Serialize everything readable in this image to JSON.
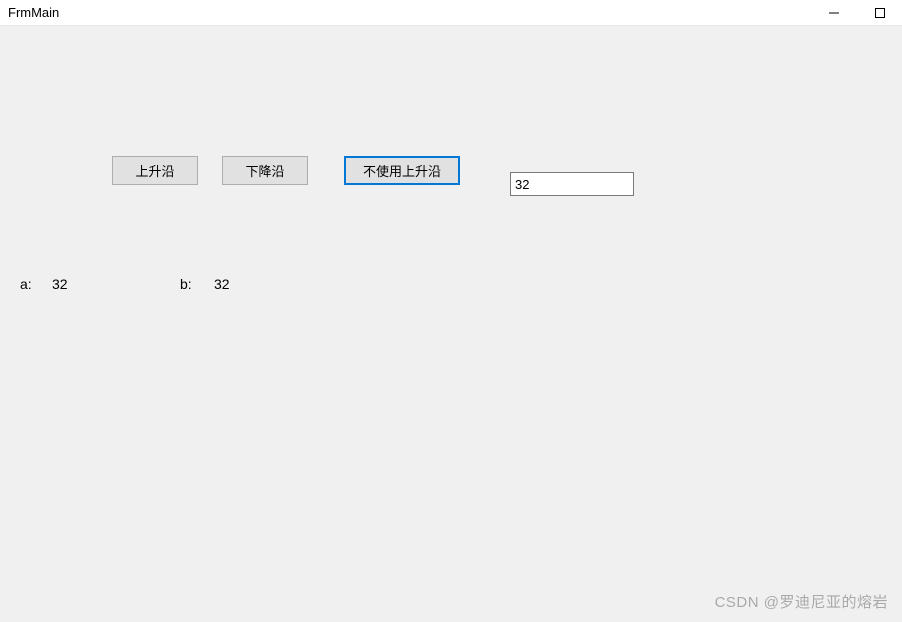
{
  "window": {
    "title": "FrmMain"
  },
  "buttons": {
    "rising_label": "上升沿",
    "falling_label": "下降沿",
    "disable_rising_label": "不使用上升沿"
  },
  "textbox": {
    "value": "32"
  },
  "labels": {
    "a_label": "a:",
    "a_value": "32",
    "b_label": "b:",
    "b_value": "32"
  },
  "watermark": "CSDN @罗迪尼亚的熔岩"
}
